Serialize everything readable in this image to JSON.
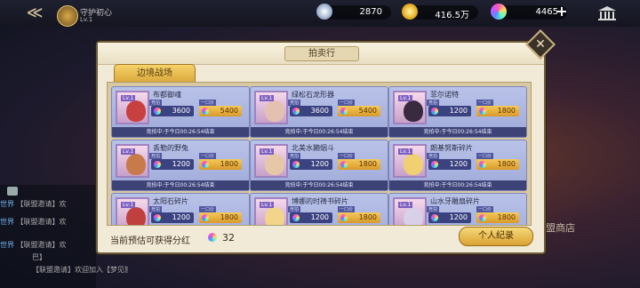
{
  "top_bar": {
    "guild_name": "守护初心",
    "guild_level": "Lv.1",
    "resources": [
      {
        "icon": "silver-coin-icon",
        "value": "2870"
      },
      {
        "icon": "gold-coin-icon",
        "value": "416.5万"
      },
      {
        "icon": "rainbow-gem-icon",
        "value": "4465"
      }
    ],
    "plus_label": "+"
  },
  "chat": {
    "lines": [
      {
        "tag": "世界",
        "text": "【联盟邀请】欢"
      },
      {
        "tag": "世界",
        "text": "【联盟邀请】欢"
      },
      {
        "tag": "世界",
        "text": "【联盟邀请】欢"
      },
      {
        "tag": "",
        "text": "巴】"
      },
      {
        "tag": "",
        "text": "【联盟邀请】欢迎加入【梦见族"
      }
    ]
  },
  "background_label": "盟商店",
  "panel": {
    "title": "拍卖行",
    "close_label": "✕",
    "tab_label": "边境战场",
    "items": [
      {
        "name": "布都御魂",
        "level": "Lv.1",
        "bid_label": "竞拍",
        "fixed_label": "一口价",
        "bid_price": "3600",
        "fixed_price": "5400",
        "time": "竞拍中:于今日00:26:54结束",
        "face_color": "#c84040"
      },
      {
        "name": "绿松石龙形器",
        "level": "Lv.1",
        "bid_label": "竞拍",
        "fixed_label": "一口价",
        "bid_price": "3600",
        "fixed_price": "5400",
        "time": "竞拍中:于今日00:26:54结束",
        "face_color": "#e4c0b0"
      },
      {
        "name": "菲尔诺特",
        "level": "Lv.1",
        "bid_label": "竞拍",
        "fixed_label": "一口价",
        "bid_price": "1200",
        "fixed_price": "1800",
        "time": "竞拍中:于今日00:26:54结束",
        "face_color": "#3a2a40"
      },
      {
        "name": "丢勒的野兔",
        "level": "Lv.1",
        "bid_label": "竞拍",
        "fixed_label": "一口价",
        "bid_price": "1200",
        "fixed_price": "1800",
        "time": "竞拍中:于今日00:26:54结束",
        "face_color": "#c97a4a"
      },
      {
        "name": "北美水獭烟斗",
        "level": "Lv.1",
        "bid_label": "竞拍",
        "fixed_label": "一口价",
        "bid_price": "1200",
        "fixed_price": "1800",
        "time": "竞拍中:于今日00:26:54结束",
        "face_color": "#e6c8a8"
      },
      {
        "name": "朗基努斯碎片",
        "level": "Lv.1",
        "bid_label": "竞拍",
        "fixed_label": "一口价",
        "bid_price": "1200",
        "fixed_price": "1800",
        "time": "竞拍中:于今日00:26:54结束",
        "face_color": "#f0d070"
      },
      {
        "name": "太阳石碎片",
        "level": "Lv.1",
        "bid_label": "竞拍",
        "fixed_label": "一口价",
        "bid_price": "1200",
        "fixed_price": "1800",
        "time": "",
        "face_color": "#c04040"
      },
      {
        "name": "博娜的时祷书碎片",
        "level": "Lv.1",
        "bid_label": "竞拍",
        "fixed_label": "一口价",
        "bid_price": "1200",
        "fixed_price": "1800",
        "time": "",
        "face_color": "#f2d58a"
      },
      {
        "name": "山水牙雕扇碎片",
        "level": "Lv.1",
        "bid_label": "竞拍",
        "fixed_label": "一口价",
        "bid_price": "1200",
        "fixed_price": "1800",
        "time": "",
        "face_color": "#d8d0e8"
      }
    ],
    "bonus_text": "当前预估可获得分红",
    "bonus_value": "32",
    "record_button": "个人纪录"
  }
}
